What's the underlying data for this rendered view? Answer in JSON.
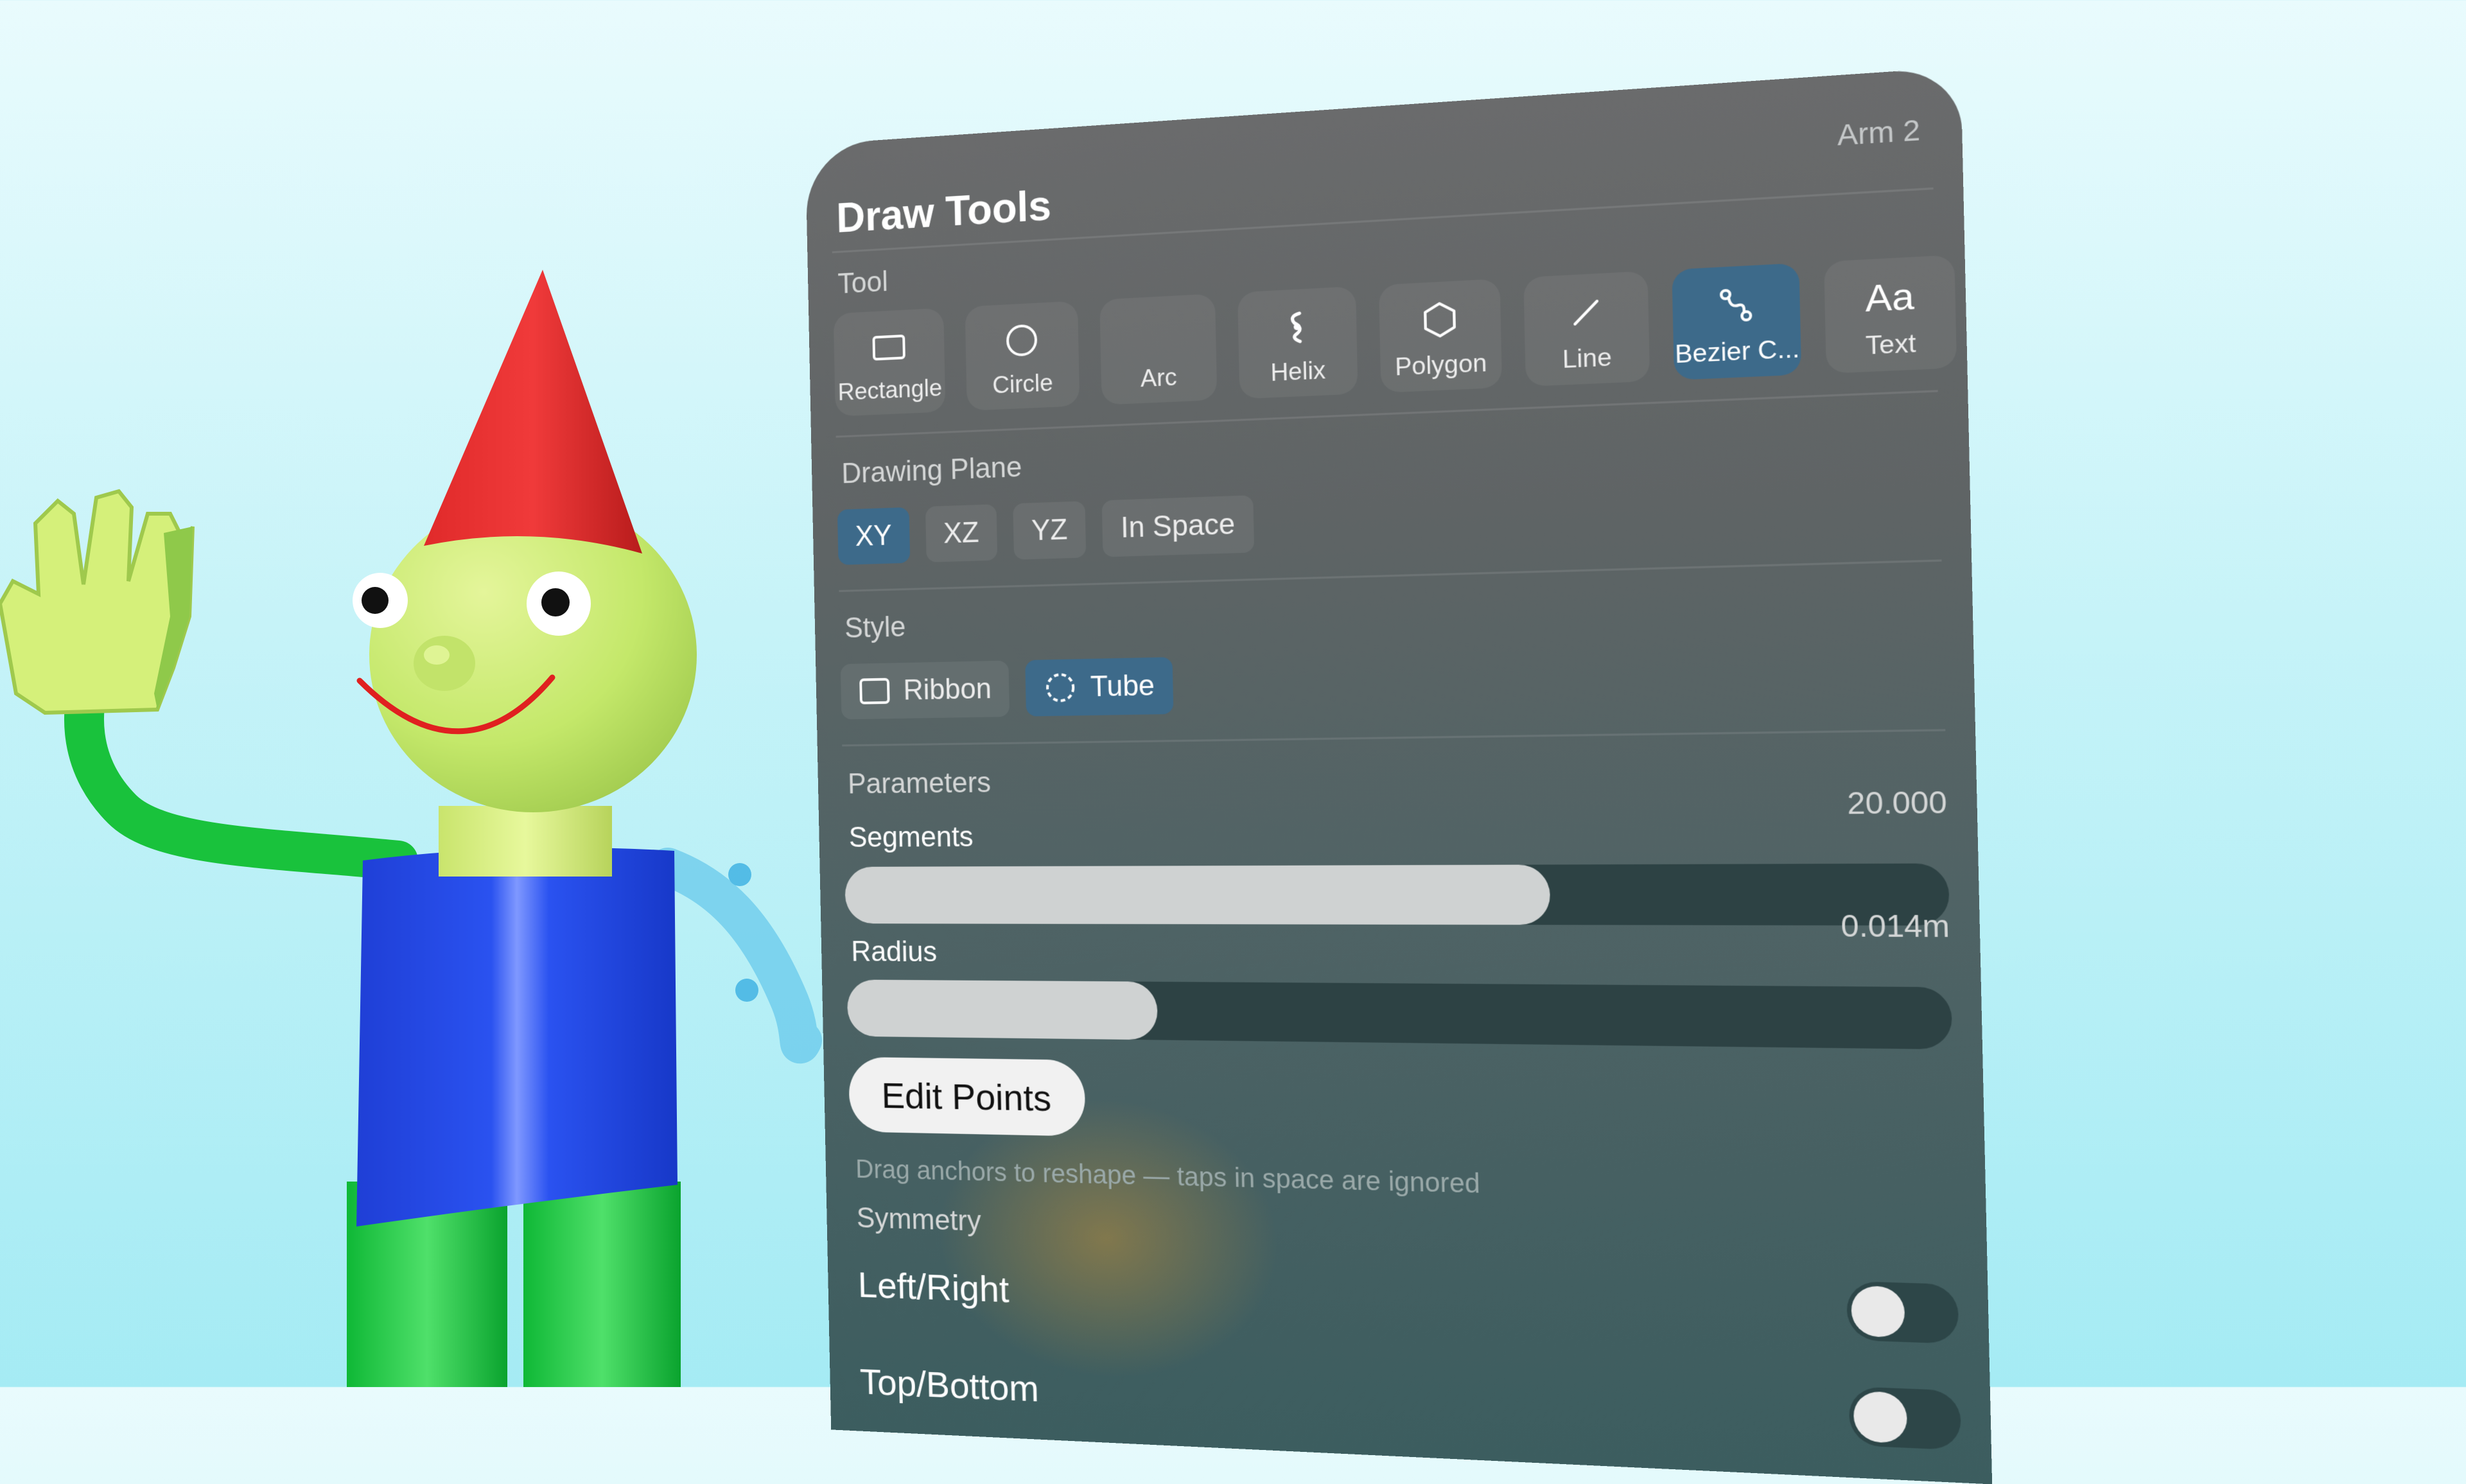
{
  "panel": {
    "title": "Draw Tools",
    "tag": "Arm 2"
  },
  "tool": {
    "label": "Tool",
    "items": [
      {
        "label": "Rectangle",
        "icon": "rectangle-icon",
        "selected": false
      },
      {
        "label": "Circle",
        "icon": "circle-icon",
        "selected": false
      },
      {
        "label": "Arc",
        "icon": "arc-icon",
        "selected": false
      },
      {
        "label": "Helix",
        "icon": "helix-icon",
        "selected": false
      },
      {
        "label": "Polygon",
        "icon": "hexagon-icon",
        "selected": false
      },
      {
        "label": "Line",
        "icon": "line-icon",
        "selected": false
      },
      {
        "label": "Bezier C...",
        "icon": "bezier-curve-icon",
        "selected": true
      },
      {
        "label": "Text",
        "icon": "text-aa-icon",
        "glyph": "Aa",
        "selected": false
      }
    ]
  },
  "drawing_plane": {
    "label": "Drawing Plane",
    "options": [
      {
        "label": "XY",
        "selected": true
      },
      {
        "label": "XZ",
        "selected": false
      },
      {
        "label": "YZ",
        "selected": false
      },
      {
        "label": "In Space",
        "selected": false
      }
    ]
  },
  "style": {
    "label": "Style",
    "options": [
      {
        "label": "Ribbon",
        "icon": "ribbon-square-icon",
        "selected": false
      },
      {
        "label": "Tube",
        "icon": "dashed-circle-icon",
        "selected": true
      }
    ]
  },
  "parameters": {
    "label": "Parameters",
    "segments": {
      "label": "Segments",
      "value": "20.000",
      "fraction": 0.66
    },
    "radius": {
      "label": "Radius",
      "value": "0.014m",
      "fraction": 0.3
    }
  },
  "edit_points": {
    "label": "Edit Points",
    "hint": "Drag anchors to reshape — taps in space are ignored"
  },
  "symmetry": {
    "label": "Symmetry",
    "left_right": {
      "label": "Left/Right",
      "on": false
    },
    "top_bottom": {
      "label": "Top/Bottom",
      "on": false
    }
  },
  "colors": {
    "accent": "#3d6a8a",
    "panel": "#5f6465",
    "background": "#c6f3f8"
  }
}
